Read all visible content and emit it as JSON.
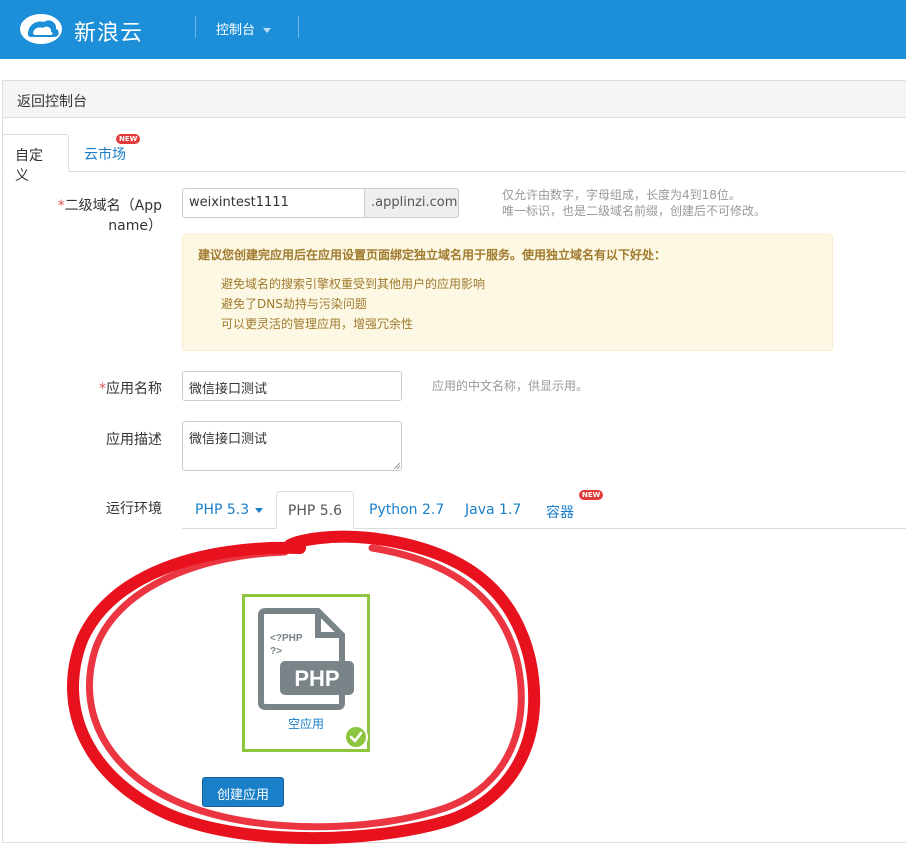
{
  "header": {
    "brand": "新浪云",
    "console_menu": "控制台",
    "bg_color": "#1c8fd8",
    "logo_icon": "cloud-icon"
  },
  "breadcrumb": {
    "back_label": "返回控制台"
  },
  "tabs": [
    {
      "label": "自定义",
      "active": true
    },
    {
      "label": "云市场",
      "badge": "NEW"
    }
  ],
  "form": {
    "app_name": {
      "required_mark": "*",
      "label": "二级域名（App name）",
      "value": "weixintest1111",
      "suffix": ".applinzi.com",
      "help_line1": "仅允许由数字，字母组成，长度为4到18位。",
      "help_line2": "唯一标识，也是二级域名前缀，创建后不可修改。"
    },
    "notice": {
      "heading": "建议您创建完应用后在应用设置页面绑定独立域名用于服务。使用独立域名有以下好处：",
      "items": [
        "避免域名的搜索引擎权重受到其他用户的应用影响",
        "避免了DNS劫持与污染问题",
        "可以更灵活的管理应用，增强冗余性"
      ]
    },
    "display_name": {
      "required_mark": "*",
      "label": "应用名称",
      "value": "微信接口测试",
      "help": "应用的中文名称，供显示用。"
    },
    "description": {
      "label": "应用描述",
      "value": "微信接口测试"
    },
    "runtime": {
      "label": "运行环境",
      "tabs": [
        {
          "label": "PHP 5.3",
          "dropdown": true
        },
        {
          "label": "PHP 5.6",
          "active": true
        },
        {
          "label": "Python 2.7"
        },
        {
          "label": "Java 1.7"
        },
        {
          "label": "容器",
          "badge": "NEW"
        }
      ]
    },
    "template_card": {
      "file_code": "<?PHP\n?>",
      "file_code_line1": "<?PHP",
      "file_code_line2": "?>",
      "file_badge": "PHP",
      "caption": "空应用",
      "selected": true,
      "icon": "php-file-icon",
      "accent": "#8cc63f"
    },
    "submit_label": "创建应用"
  },
  "colors": {
    "link": "#1a7fc9",
    "annotation": "#e8121e"
  }
}
